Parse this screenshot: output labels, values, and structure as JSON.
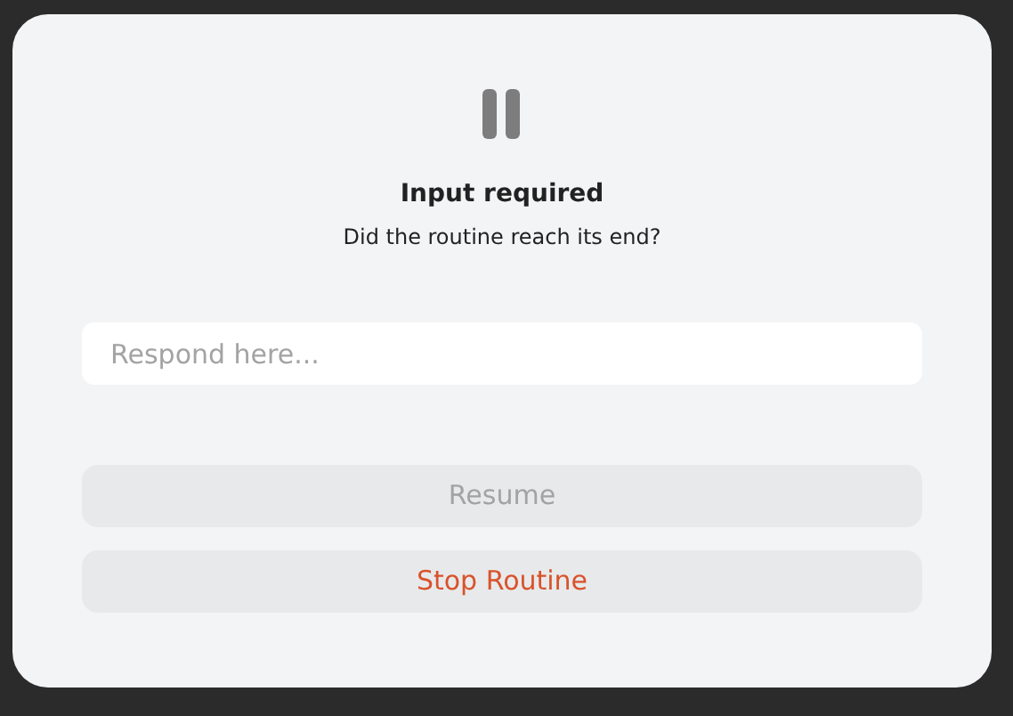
{
  "dialog": {
    "title": "Input required",
    "message": "Did the routine reach its end?"
  },
  "response": {
    "placeholder": "Respond here..."
  },
  "buttons": [
    {
      "label": "Resume",
      "kind": "primary",
      "disabled": true
    },
    {
      "label": "Stop Routine",
      "kind": "danger",
      "disabled": false
    }
  ]
}
